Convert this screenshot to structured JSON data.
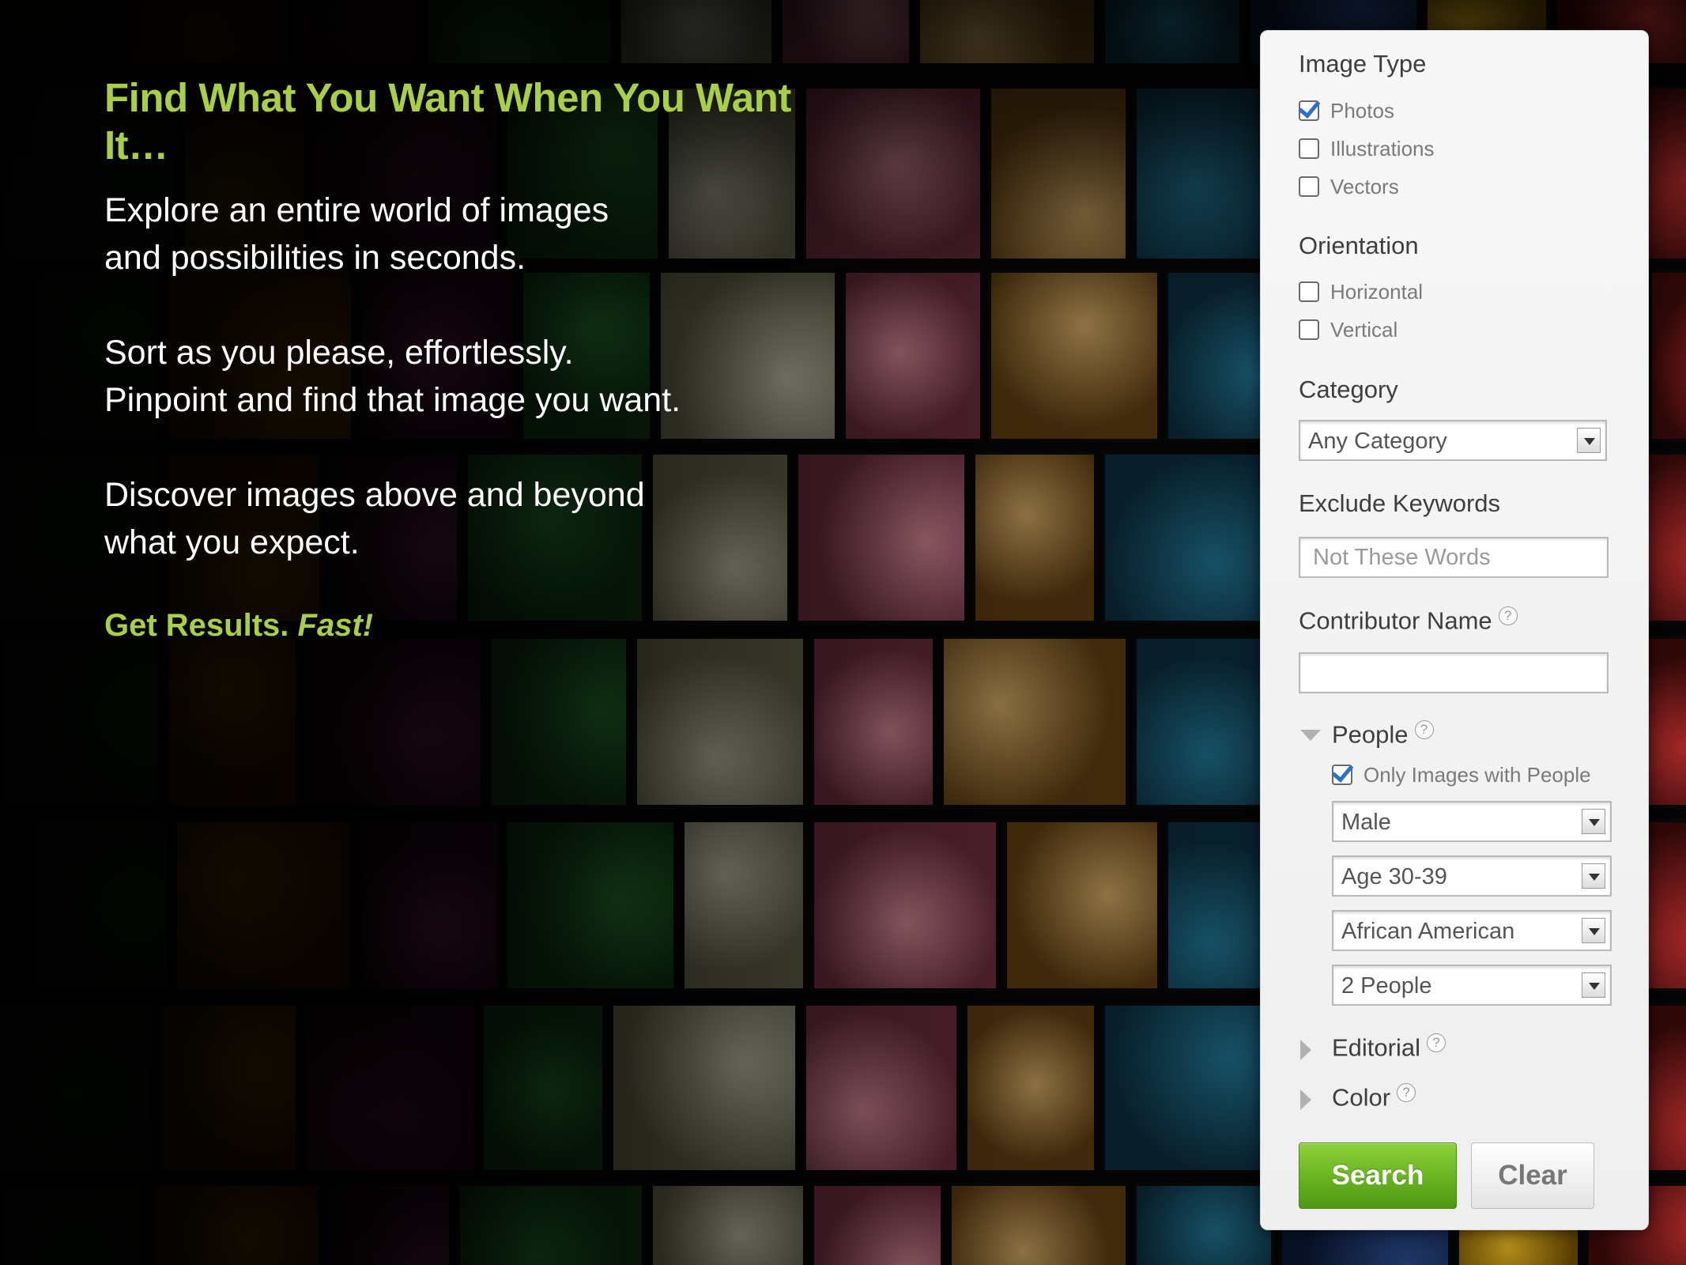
{
  "hero": {
    "headline": "Find What You Want When You Want It…",
    "p1_line1": "Explore an entire world of images",
    "p1_line2": "and possibilities in seconds.",
    "p2_line1": "Sort as you please, effortlessly.",
    "p2_line2": "Pinpoint and find that image you want.",
    "p3_line1": "Discover images above and beyond",
    "p3_line2": "what you expect.",
    "tagline_start": "Get Results.",
    "tagline_emphasis": "Fast!"
  },
  "panel": {
    "image_type": {
      "title": "Image Type",
      "options": [
        {
          "label": "Photos",
          "checked": true
        },
        {
          "label": "Illustrations",
          "checked": false
        },
        {
          "label": "Vectors",
          "checked": false
        }
      ]
    },
    "orientation": {
      "title": "Orientation",
      "options": [
        {
          "label": "Horizontal",
          "checked": false
        },
        {
          "label": "Vertical",
          "checked": false
        }
      ]
    },
    "category": {
      "title": "Category",
      "selected": "Any Category"
    },
    "exclude": {
      "title": "Exclude Keywords",
      "placeholder": "Not These Words"
    },
    "contributor": {
      "title": "Contributor Name",
      "value": ""
    },
    "people": {
      "title": "People",
      "expanded": true,
      "only_people_label": "Only Images with People",
      "only_people_checked": true,
      "gender": "Male",
      "age": "Age 30-39",
      "ethnicity": "African American",
      "count": "2 People"
    },
    "editorial": {
      "title": "Editorial",
      "expanded": false
    },
    "color": {
      "title": "Color",
      "expanded": false
    },
    "help_glyph": "?",
    "search_label": "Search",
    "clear_label": "Clear"
  },
  "mosaic_palette": [
    [
      "#3a6b2a",
      "#1c3315"
    ],
    [
      "#1f6d8a",
      "#0b2b3a"
    ],
    [
      "#7a5a22",
      "#2a1f0c"
    ],
    [
      "#d98a9a",
      "#6a2c3c"
    ],
    [
      "#c45a2a",
      "#5a200c"
    ],
    [
      "#2e8a3a",
      "#0f3a16"
    ],
    [
      "#c93030",
      "#3a0a0a"
    ],
    [
      "#e58a10",
      "#6a2a00"
    ],
    [
      "#2a4a8a",
      "#0a1630"
    ],
    [
      "#a04a7a",
      "#3a1030"
    ],
    [
      "#c8a060",
      "#5a3a10"
    ],
    [
      "#f06a20",
      "#8a1a00"
    ],
    [
      "#d8d8c0",
      "#6a6a50"
    ],
    [
      "#4aa0c0",
      "#103a50"
    ],
    [
      "#8a2a60",
      "#2a0a20"
    ],
    [
      "#e0b020",
      "#6a4a00"
    ]
  ]
}
